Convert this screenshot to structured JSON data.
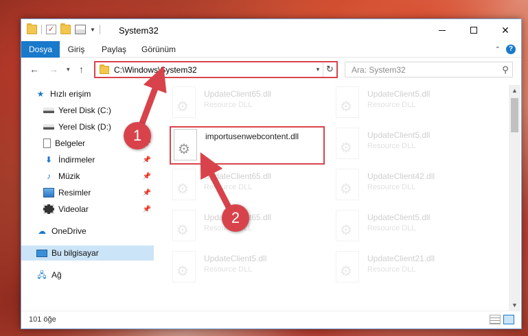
{
  "window": {
    "title": "System32",
    "controls": {
      "minimize": "minimize-icon",
      "maximize": "maximize-icon",
      "close": "✕"
    }
  },
  "ribbon": {
    "tabs": [
      "Dosya",
      "Giriş",
      "Paylaş",
      "Görünüm"
    ],
    "help": "?"
  },
  "navigation": {
    "address": "C:\\Windows\\System32",
    "search_placeholder": "Ara: System32"
  },
  "sidebar": {
    "items": [
      {
        "label": "Hızlı erişim",
        "icon": "star-icon"
      },
      {
        "label": "Yerel Disk (C:)",
        "icon": "drive-icon"
      },
      {
        "label": "Yerel Disk (D:)",
        "icon": "drive-icon"
      },
      {
        "label": "Belgeler",
        "icon": "documents-icon",
        "pinned": true
      },
      {
        "label": "İndirmeler",
        "icon": "downloads-icon",
        "pinned": true
      },
      {
        "label": "Müzik",
        "icon": "music-icon",
        "pinned": true
      },
      {
        "label": "Resimler",
        "icon": "pictures-icon",
        "pinned": true
      },
      {
        "label": "Videolar",
        "icon": "videos-icon",
        "pinned": true
      },
      {
        "label": "OneDrive",
        "icon": "onedrive-icon"
      },
      {
        "label": "Bu bilgisayar",
        "icon": "this-pc-icon",
        "selected": true
      },
      {
        "label": "Ağ",
        "icon": "network-icon"
      }
    ]
  },
  "files": [
    {
      "name": "UpdateClient65.dll",
      "type": "Resource DLL"
    },
    {
      "name": "UpdateClient5.dll",
      "type": "Resource DLL"
    },
    {
      "name": "importusenwebcontent.dll",
      "type": "",
      "highlighted": true
    },
    {
      "name": "UpdateClient5.dll",
      "type": "Resource DLL"
    },
    {
      "name": "UpdateClient65.dll",
      "type": "Resource DLL"
    },
    {
      "name": "UpdateClient42.dll",
      "type": "Resource DLL"
    },
    {
      "name": "UpdateClient65.dll",
      "type": "Resource DLL"
    },
    {
      "name": "UpdateClient5.dll",
      "type": "Resource DLL"
    },
    {
      "name": "UpdateClient5.dll",
      "type": "Resource DLL"
    },
    {
      "name": "UpdateClient21.dll",
      "type": "Resource DLL"
    }
  ],
  "status": {
    "count": "101 öğe"
  },
  "annotations": {
    "step1": "1",
    "step2": "2"
  },
  "colors": {
    "accent": "#1979ca",
    "highlight": "#d8434b"
  }
}
